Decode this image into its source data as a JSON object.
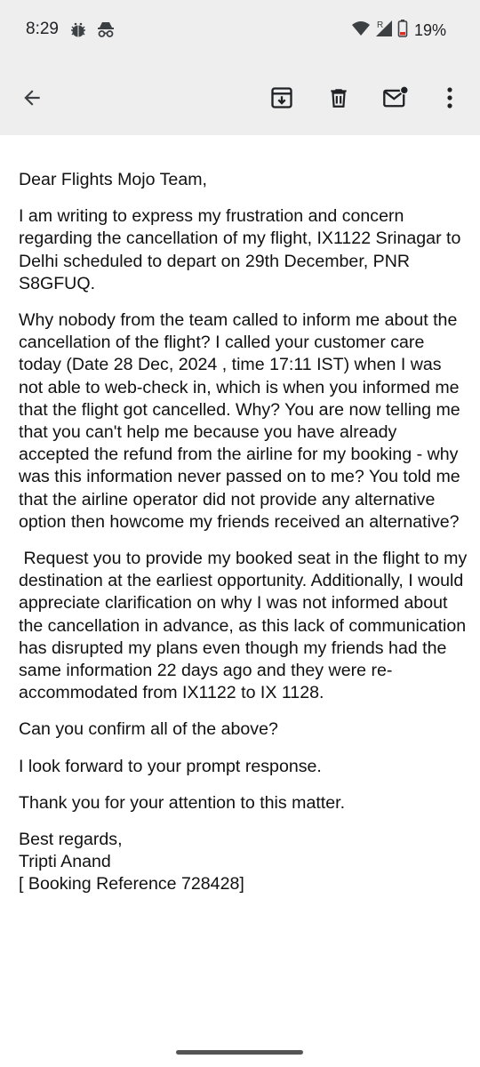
{
  "status_bar": {
    "time": "8:29",
    "battery_percent": "19%",
    "icons": [
      "notification-bug-icon",
      "incognito-icon",
      "wifi-icon",
      "roaming-signal-icon",
      "battery-icon"
    ]
  },
  "toolbar": {
    "icons": [
      "back-arrow-icon",
      "archive-icon",
      "delete-icon",
      "mark-unread-icon",
      "more-options-icon"
    ]
  },
  "email": {
    "paragraphs": [
      "Dear Flights Mojo Team,",
      "I am writing to express my frustration and concern regarding the cancellation of my flight, IX1122 Srinagar to Delhi scheduled to depart on 29th December, PNR S8GFUQ.",
      "Why nobody from the team called to inform me about the cancellation of the flight? I called your customer care today (Date 28 Dec, 2024 , time 17:11 IST) when I was not able to web-check in, which is when you informed me that the flight got cancelled. Why? You are now telling me that you can't help me because you have already accepted the refund from the airline for my booking - why was this information never passed on to me? You told me that the airline operator did not provide any alternative option then howcome my friends received an alternative?",
      " Request you to provide my booked seat in the flight to my destination at the earliest opportunity. Additionally, I would appreciate clarification on why I was not informed about the cancellation in advance, as this lack of communication has disrupted my plans even though my friends had the same information 22 days ago and they were re-accommodated from IX1122 to IX 1128.",
      "Can you confirm all of the above?",
      "I look forward to your prompt response.",
      "Thank you for your attention to this matter."
    ],
    "signoff": "Best regards,",
    "name": "Tripti Anand",
    "reference": "[ Booking Reference 728428]"
  }
}
